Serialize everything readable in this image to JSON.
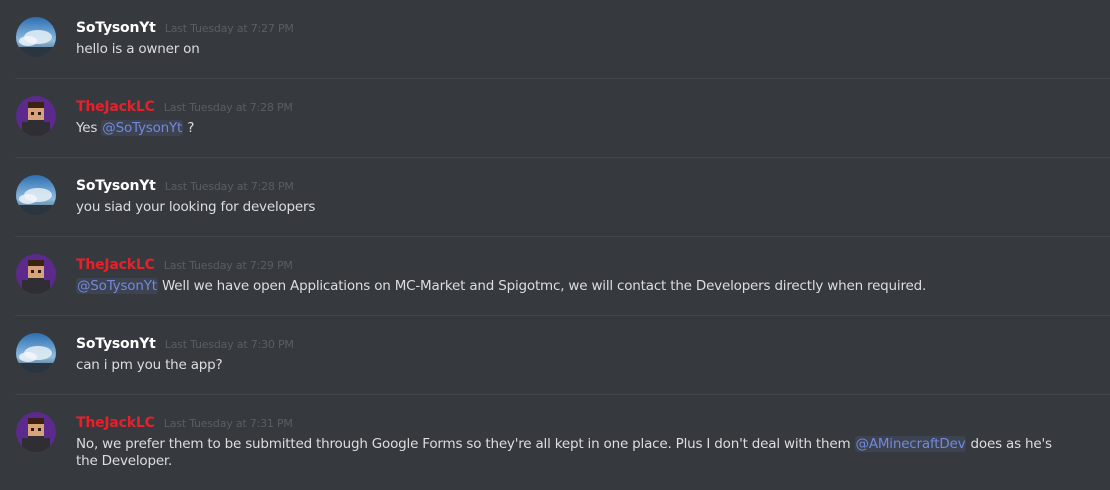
{
  "colors": {
    "background": "#36393e",
    "divider": "#414449",
    "username_default": "#ffffff",
    "username_role": "#e8202a",
    "timestamp": "#5a5d62",
    "mention": "#7289da"
  },
  "messages": [
    {
      "username": "SoTysonYt",
      "timestamp": "Last Tuesday at 7:27 PM",
      "avatar": "sky-avatar",
      "text_before": "hello is a owner on",
      "mention": "",
      "text_after": ""
    },
    {
      "username": "TheJackLC",
      "timestamp": "Last Tuesday at 7:28 PM",
      "avatar": "minecraft-skin-avatar",
      "text_before": "Yes ",
      "mention": "@SoTysonYt",
      "text_after": " ?"
    },
    {
      "username": "SoTysonYt",
      "timestamp": "Last Tuesday at 7:28 PM",
      "avatar": "sky-avatar",
      "text_before": "you siad your looking for developers",
      "mention": "",
      "text_after": ""
    },
    {
      "username": "TheJackLC",
      "timestamp": "Last Tuesday at 7:29 PM",
      "avatar": "minecraft-skin-avatar",
      "text_before": "",
      "mention": "@SoTysonYt",
      "text_after": " Well we have open Applications on MC-Market and Spigotmc, we will contact the Developers directly when required."
    },
    {
      "username": "SoTysonYt",
      "timestamp": "Last Tuesday at 7:30 PM",
      "avatar": "sky-avatar",
      "text_before": "can i pm you the app?",
      "mention": "",
      "text_after": ""
    },
    {
      "username": "TheJackLC",
      "timestamp": "Last Tuesday at 7:31 PM",
      "avatar": "minecraft-skin-avatar",
      "text_before": "No, we prefer them to be submitted through Google Forms so they're all kept in one place. Plus I don't deal with them ",
      "mention": "@AMinecraftDev",
      "text_after": " does as he's the Developer."
    }
  ]
}
